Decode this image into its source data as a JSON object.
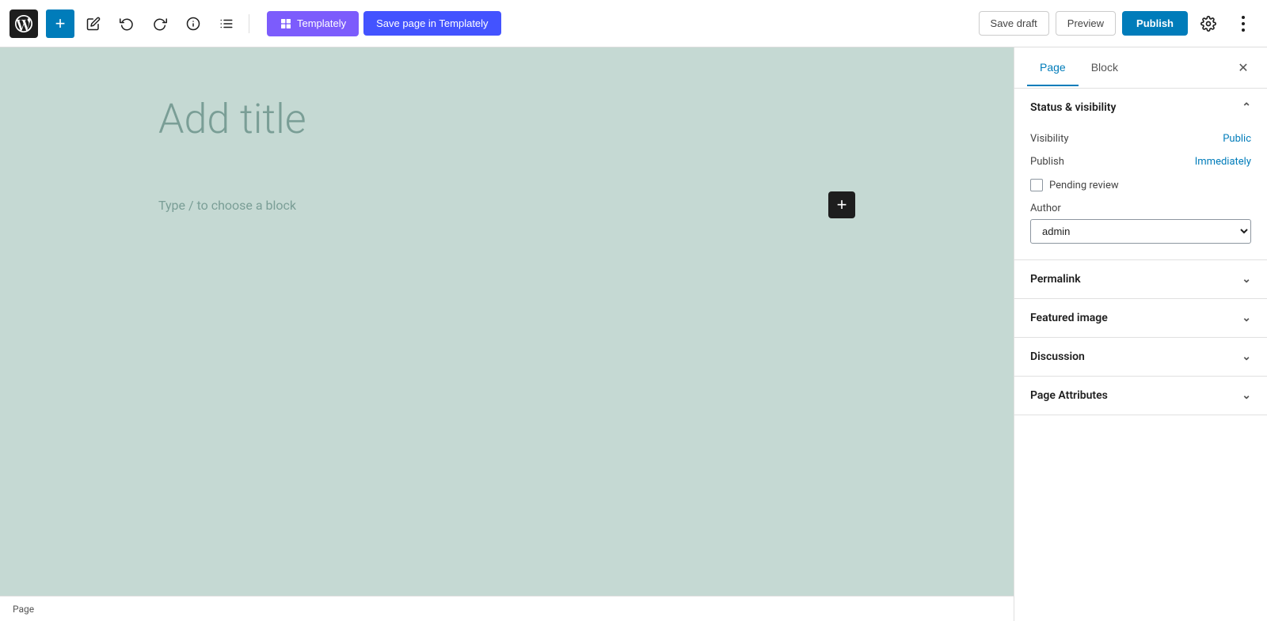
{
  "toolbar": {
    "wp_logo_alt": "WordPress",
    "add_block_label": "+",
    "tools_label": "✏",
    "undo_label": "↩",
    "redo_label": "↪",
    "info_label": "ℹ",
    "list_view_label": "≡",
    "templately_label": "Templately",
    "save_page_templately_label": "Save page in Templately",
    "save_draft_label": "Save draft",
    "preview_label": "Preview",
    "publish_label": "Publish",
    "settings_label": "⚙",
    "more_label": "⋮"
  },
  "editor": {
    "title_placeholder": "Add title",
    "block_placeholder": "Type / to choose a block",
    "add_block_icon": "+"
  },
  "status_bar": {
    "label": "Page"
  },
  "sidebar": {
    "tab_page": "Page",
    "tab_block": "Block",
    "close_label": "✕",
    "sections": {
      "status_visibility": {
        "title": "Status & visibility",
        "expanded": true,
        "visibility_label": "Visibility",
        "visibility_value": "Public",
        "publish_label": "Publish",
        "publish_value": "Immediately",
        "pending_review_label": "Pending review",
        "author_label": "Author",
        "author_value": "admin"
      },
      "permalink": {
        "title": "Permalink",
        "expanded": false
      },
      "featured_image": {
        "title": "Featured image",
        "expanded": false
      },
      "discussion": {
        "title": "Discussion",
        "expanded": false
      },
      "page_attributes": {
        "title": "Page Attributes",
        "expanded": false
      }
    }
  }
}
